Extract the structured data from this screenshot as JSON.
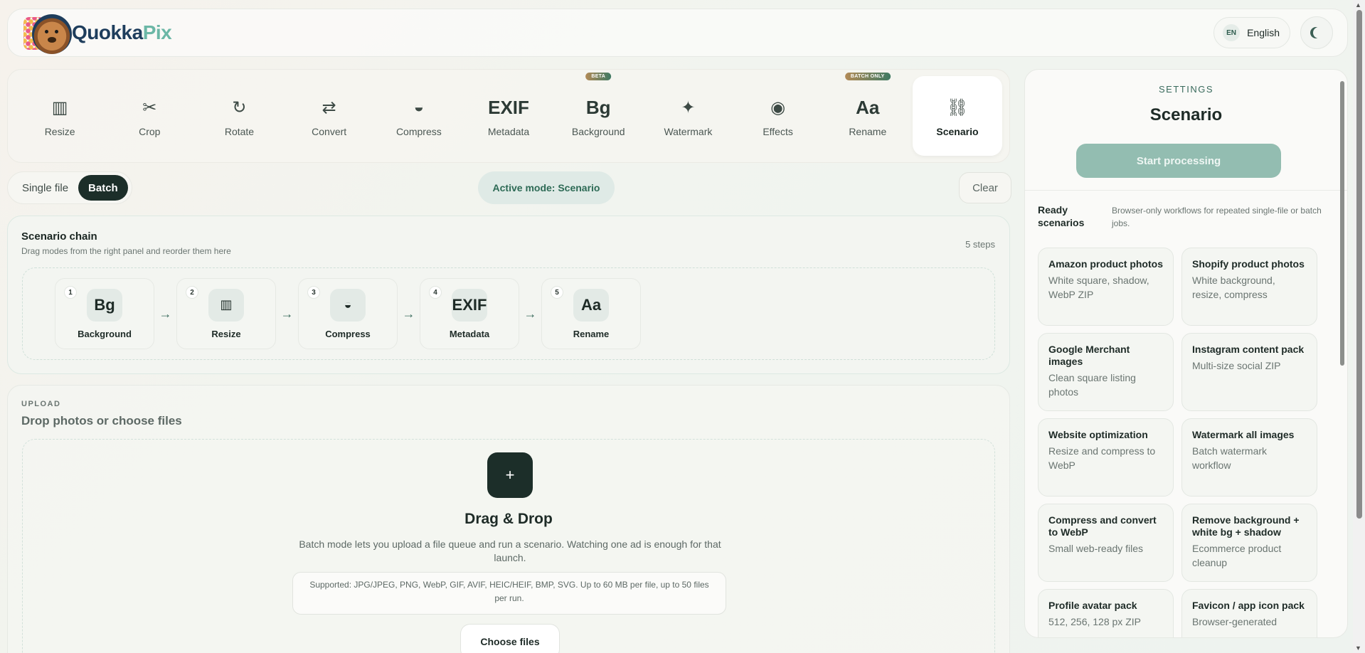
{
  "header": {
    "logo_text_a": "Quokka",
    "logo_text_b": "Pix",
    "lang_code": "EN",
    "lang_label": "English"
  },
  "modes": [
    {
      "label": "Resize",
      "icon": "▥",
      "icon_name": "resize-icon",
      "badge": ""
    },
    {
      "label": "Crop",
      "icon": "✂",
      "icon_name": "crop-icon",
      "badge": ""
    },
    {
      "label": "Rotate",
      "icon": "↻",
      "icon_name": "rotate-icon",
      "badge": ""
    },
    {
      "label": "Convert",
      "icon": "⇄",
      "icon_name": "convert-icon",
      "badge": ""
    },
    {
      "label": "Compress",
      "icon": "◒",
      "icon_name": "compress-icon",
      "badge": ""
    },
    {
      "label": "Metadata",
      "icon": "EXIF",
      "icon_name": "exif-icon",
      "badge": ""
    },
    {
      "label": "Background",
      "icon": "Bg",
      "icon_name": "background-icon",
      "badge": "BETA"
    },
    {
      "label": "Watermark",
      "icon": "✦",
      "icon_name": "watermark-icon",
      "badge": ""
    },
    {
      "label": "Effects",
      "icon": "◉",
      "icon_name": "effects-icon",
      "badge": ""
    },
    {
      "label": "Rename",
      "icon": "Aa",
      "icon_name": "rename-icon",
      "badge": "BATCH ONLY"
    },
    {
      "label": "Scenario",
      "icon": "⛓",
      "icon_name": "scenario-icon",
      "badge": ""
    }
  ],
  "toolbar": {
    "single_file": "Single file",
    "batch": "Batch",
    "active_mode": "Active mode: Scenario",
    "clear": "Clear"
  },
  "chain": {
    "title": "Scenario chain",
    "subtitle": "Drag modes from the right panel and reorder them here",
    "count": "5 steps",
    "steps": [
      {
        "num": "1",
        "icon": "Bg",
        "label": "Background"
      },
      {
        "num": "2",
        "icon": "▥",
        "label": "Resize"
      },
      {
        "num": "3",
        "icon": "◒",
        "label": "Compress"
      },
      {
        "num": "4",
        "icon": "EXIF",
        "label": "Metadata"
      },
      {
        "num": "5",
        "icon": "Aa",
        "label": "Rename"
      }
    ],
    "arrow": "→"
  },
  "upload": {
    "eyebrow": "UPLOAD",
    "title": "Drop photos or choose files",
    "plus": "+",
    "dd_title": "Drag & Drop",
    "dd_desc": "Batch mode lets you upload a file queue and run a scenario. Watching one ad is enough for that launch.",
    "supported": "Supported: JPG/JPEG, PNG, WebP, GIF, AVIF, HEIC/HEIF, BMP, SVG. Up to 60 MB per file, up to 50 files per run.",
    "choose": "Choose files"
  },
  "settings": {
    "eyebrow": "SETTINGS",
    "title": "Scenario",
    "start": "Start processing",
    "ready_label": "Ready scenarios",
    "ready_desc": "Browser-only workflows for repeated single-file or batch jobs.",
    "cards": [
      {
        "title": "Amazon product photos",
        "desc": "White square, shadow, WebP ZIP"
      },
      {
        "title": "Shopify product photos",
        "desc": "White background, resize, compress"
      },
      {
        "title": "Google Merchant images",
        "desc": "Clean square listing photos"
      },
      {
        "title": "Instagram content pack",
        "desc": "Multi-size social ZIP"
      },
      {
        "title": "Website optimization",
        "desc": "Resize and compress to WebP"
      },
      {
        "title": "Watermark all images",
        "desc": "Batch watermark workflow"
      },
      {
        "title": "Compress and convert to WebP",
        "desc": "Small web-ready files"
      },
      {
        "title": "Remove background + white bg + shadow",
        "desc": "Ecommerce product cleanup"
      },
      {
        "title": "Profile avatar pack",
        "desc": "512, 256, 128 px ZIP"
      },
      {
        "title": "Favicon / app icon pack",
        "desc": "Browser-generated"
      }
    ]
  },
  "colors": {
    "accent": "#1c2e29",
    "brand_green": "#3a6b5d",
    "start_button": "#93bdb1"
  }
}
